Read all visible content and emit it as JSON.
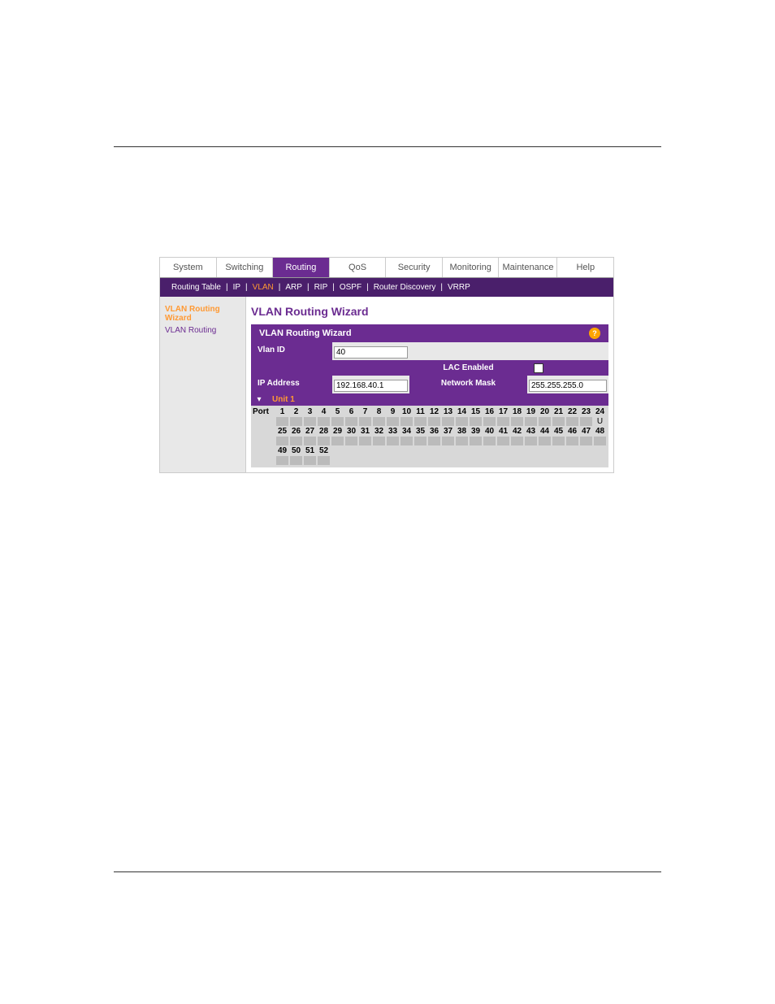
{
  "main_tabs": [
    "System",
    "Switching",
    "Routing",
    "QoS",
    "Security",
    "Monitoring",
    "Maintenance",
    "Help"
  ],
  "main_tab_active": 2,
  "sub_tabs": [
    "Routing Table",
    "IP",
    "VLAN",
    "ARP",
    "RIP",
    "OSPF",
    "Router Discovery",
    "VRRP"
  ],
  "sub_tab_active": 2,
  "sidebar": {
    "items": [
      {
        "label": "VLAN Routing Wizard",
        "active": true
      },
      {
        "label": "VLAN Routing",
        "active": false
      }
    ]
  },
  "panel": {
    "title": "VLAN Routing Wizard",
    "section_title": "VLAN Routing Wizard"
  },
  "form": {
    "vlan_id_label": "Vlan ID",
    "vlan_id_value": "40",
    "lac_enabled_label": "LAC Enabled",
    "ip_address_label": "IP Address",
    "ip_address_value": "192.168.40.1",
    "network_mask_label": "Network Mask",
    "network_mask_value": "255.255.255.0",
    "unit_label": "Unit 1"
  },
  "ports": {
    "row_label": "Port",
    "row1": [
      "1",
      "2",
      "3",
      "4",
      "5",
      "6",
      "7",
      "8",
      "9",
      "10",
      "11",
      "12",
      "13",
      "14",
      "15",
      "16",
      "17",
      "18",
      "19",
      "20",
      "21",
      "22",
      "23",
      "24"
    ],
    "port24_state": "U",
    "row2": [
      "25",
      "26",
      "27",
      "28",
      "29",
      "30",
      "31",
      "32",
      "33",
      "34",
      "35",
      "36",
      "37",
      "38",
      "39",
      "40",
      "41",
      "42",
      "43",
      "44",
      "45",
      "46",
      "47",
      "48"
    ],
    "row3": [
      "49",
      "50",
      "51",
      "52"
    ]
  }
}
